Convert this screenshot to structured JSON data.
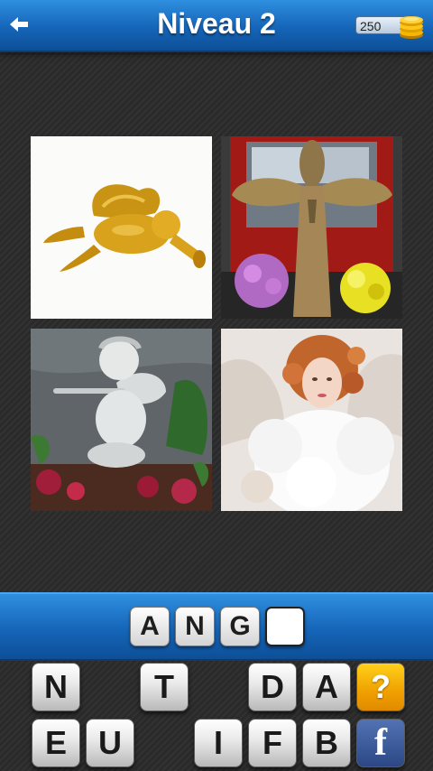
{
  "header": {
    "title": "Niveau 2",
    "coins": "250"
  },
  "images": [
    {
      "icon": "golden-cherub-ornament-image"
    },
    {
      "icon": "straw-angel-statue-image"
    },
    {
      "icon": "stone-cherub-flute-image"
    },
    {
      "icon": "porcelain-angel-doll-image"
    }
  ],
  "answer": {
    "slots": [
      "A",
      "N",
      "G",
      ""
    ]
  },
  "letters": {
    "row1": [
      "N",
      "T",
      "D",
      "A"
    ],
    "row2": [
      "E",
      "U",
      "I",
      "F",
      "B"
    ],
    "hint_label": "?",
    "share_label": "f"
  },
  "colors": {
    "header_blue": "#1565b8",
    "hint_orange": "#f0a000",
    "facebook_blue": "#3b5998"
  }
}
